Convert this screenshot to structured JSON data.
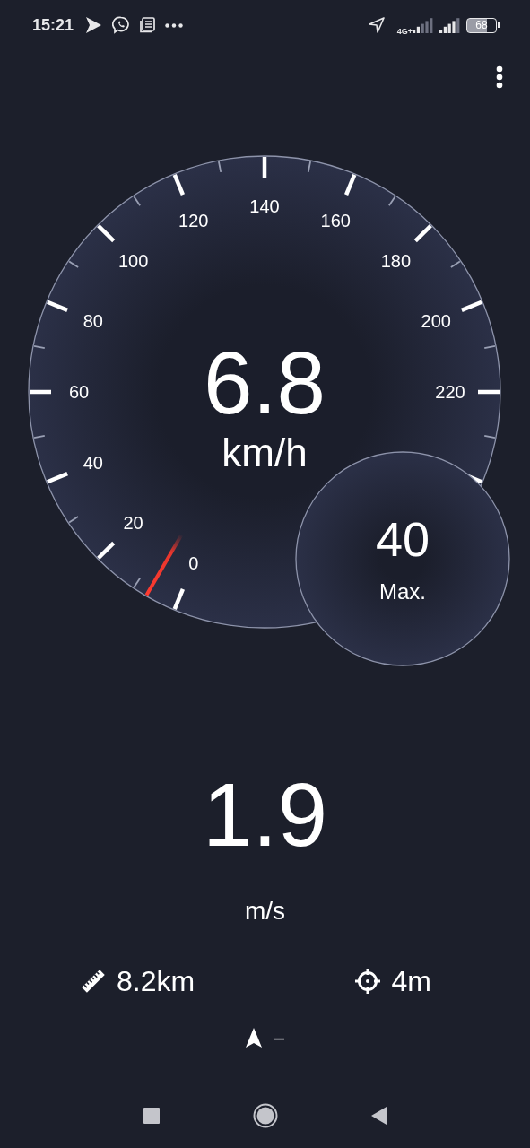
{
  "status_bar": {
    "time": "15:21",
    "network": "4G+",
    "battery": "68"
  },
  "gauge": {
    "scale_labels": [
      "0",
      "20",
      "40",
      "60",
      "80",
      "100",
      "120",
      "140",
      "160",
      "180",
      "200",
      "220"
    ],
    "speed": "6.8",
    "unit": "km/h"
  },
  "max_speed": {
    "value": "40",
    "label": "Max."
  },
  "secondary_speed": {
    "value": "1.9",
    "unit": "m/s"
  },
  "stats": [
    {
      "kind": "distance",
      "value": "8.2km"
    },
    {
      "kind": "accuracy",
      "value": "4m"
    }
  ],
  "heading": {
    "value": "–"
  }
}
